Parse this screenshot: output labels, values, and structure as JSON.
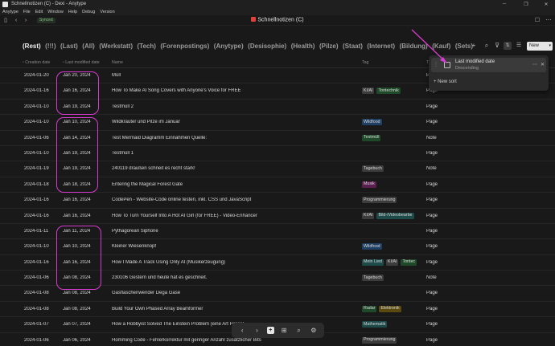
{
  "window": {
    "title": "Schnellnotizen (C) - Dexi - Anytype",
    "minimize": "─",
    "restore": "❐",
    "close": "✕"
  },
  "menu": [
    "Anytype",
    "File",
    "Edit",
    "Window",
    "Help",
    "Debug",
    "Version"
  ],
  "toolbar": {
    "sync_status": "Synced",
    "object_title": "Schnellnotizen (C)"
  },
  "tabs": [
    "(Rest)",
    "(!!!)",
    "(Last)",
    "(All)",
    "(Werkstatt)",
    "(Tech)",
    "(Forenpostings)",
    "(Anytype)",
    "(Desisophie)",
    "(Health)",
    "(Pilze)",
    "(Staat)",
    "(Internet)",
    "(Bildung)",
    "(Kauf)",
    "(Sets)"
  ],
  "active_tab": 0,
  "view_buttons": {
    "add": "+",
    "new_label": "New"
  },
  "columns": {
    "created": "Creation date",
    "modified": "Last modified date",
    "name": "Name",
    "tag": "Tag",
    "type": "Type"
  },
  "rows": [
    {
      "created": "2024-01-20",
      "modified": "Jan 20, 2024",
      "name": "Müll",
      "tags": [],
      "type": "Page"
    },
    {
      "created": "2024-01-16",
      "modified": "Jan 16, 2024",
      "name": "How To Make AI Song Covers with Anyone's Voice for FREE",
      "tags": [
        {
          "text": "KI/AI",
          "color": "#3c3c3c"
        },
        {
          "text": "Tontechnik",
          "color": "#1f4a2a"
        }
      ],
      "type": "Page"
    },
    {
      "created": "2024-01-10",
      "modified": "Jan 19, 2024",
      "name": "Testmüll 2",
      "tags": [],
      "type": "Page"
    },
    {
      "created": "2024-01-10",
      "modified": "Jan 10, 2024",
      "name": "Wildkräuter und Pilze im Januar",
      "tags": [
        {
          "text": "Wildfood",
          "color": "#1f3f63"
        }
      ],
      "type": "Page"
    },
    {
      "created": "2024-01-06",
      "modified": "Jan 14, 2024",
      "name": "Test Mermaid Diagramm Einnahmen Quelle:",
      "tags": [
        {
          "text": "Testmüll",
          "color": "#1f4a2a"
        }
      ],
      "type": "Note"
    },
    {
      "created": "2024-01-10",
      "modified": "Jan 19, 2024",
      "name": "Testmüll 1",
      "tags": [],
      "type": "Page"
    },
    {
      "created": "2024-01-19",
      "modified": "Jan 19, 2024",
      "name": "240119 draußen schneit es recht stark!",
      "tags": [
        {
          "text": "Tagebuch",
          "color": "#3c3c3c"
        }
      ],
      "type": "Note"
    },
    {
      "created": "2024-01-18",
      "modified": "Jan 18, 2024",
      "name": "Entering the Magical Forest Gate",
      "tags": [
        {
          "text": "Musik",
          "color": "#5a1f4f"
        }
      ],
      "type": "Page"
    },
    {
      "created": "2024-01-16",
      "modified": "Jan 16, 2024",
      "name": "CodePen - Website-Code online testen, inkl. CSS und JavaScript",
      "tags": [
        {
          "text": "Programmierung",
          "color": "#3c3c3c"
        }
      ],
      "type": "Page"
    },
    {
      "created": "2024-01-16",
      "modified": "Jan 16, 2024",
      "name": "How To Turn Yourself Into A Hot AI Girl (for FREE) - Video-Enhancer",
      "tags": [
        {
          "text": "KI/AI",
          "color": "#3c3c3c"
        },
        {
          "text": "Bild-/Videobearbe",
          "color": "#1f4a4a"
        }
      ],
      "type": "Page"
    },
    {
      "created": "2024-01-11",
      "modified": "Jan 11, 2024",
      "name": "Pythagorean Siphone",
      "tags": [],
      "type": "Page"
    },
    {
      "created": "2024-01-10",
      "modified": "Jan 10, 2024",
      "name": "Kleiner Wiesenknopf",
      "tags": [
        {
          "text": "Wildfood",
          "color": "#1f3f63"
        }
      ],
      "type": "Page"
    },
    {
      "created": "2024-01-16",
      "modified": "Jan 16, 2024",
      "name": "How I Made A Track Using Only AI (Musikerzeugung)",
      "tags": [
        {
          "text": "Mein Lied",
          "color": "#1f4a4a"
        },
        {
          "text": "KI/AI",
          "color": "#3c3c3c"
        },
        {
          "text": "Tontec",
          "color": "#1f4a2a"
        }
      ],
      "type": "Page"
    },
    {
      "created": "2024-01-06",
      "modified": "Jan 08, 2024",
      "name": "230106 Gestern und heute hat es geschneit.",
      "tags": [
        {
          "text": "Tagebuch",
          "color": "#3c3c3c"
        }
      ],
      "type": "Note"
    },
    {
      "created": "2024-01-08",
      "modified": "Jan 08, 2024",
      "name": "Gasflaschenwender Dega Gase",
      "tags": [],
      "type": "Page"
    },
    {
      "created": "2024-01-08",
      "modified": "Jan 08, 2024",
      "name": "Build Your Own Phased Array Beamformer",
      "tags": [
        {
          "text": "Radar",
          "color": "#1f4a2a"
        },
        {
          "text": "Elektronik",
          "color": "#5a4a10"
        }
      ],
      "type": "Page"
    },
    {
      "created": "2024-01-07",
      "modified": "Jan 07, 2024",
      "name": "How a Hobbyist Solved The Einstein Problem (eine Art Fliese)",
      "tags": [
        {
          "text": "Mathematik",
          "color": "#1f4a4a"
        }
      ],
      "type": "Page"
    },
    {
      "created": "2024-01-06",
      "modified": "Jan 06, 2024",
      "name": "Homming Code - Fehlerkorrektur mit geringer Anzahl zusätzlicher Bits",
      "tags": [
        {
          "text": "Programmierung",
          "color": "#3c3c3c"
        }
      ],
      "type": "Page"
    }
  ],
  "sort_popup": {
    "label": "Last modified date",
    "direction": "Descending",
    "new_sort": "New sort"
  },
  "bottom_nav": [
    "‹",
    "›",
    "+",
    "⊞",
    "⌕",
    "⚙"
  ],
  "colors": {
    "background": "#191919",
    "annotation": "#d63ccf"
  }
}
